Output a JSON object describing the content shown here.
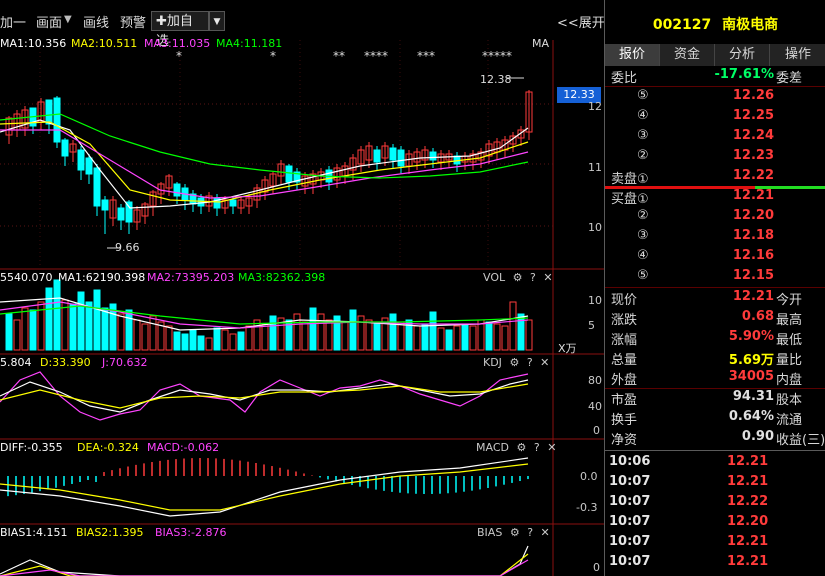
{
  "toolbar": {
    "items": [
      "加一",
      "画面",
      "画线",
      "预警"
    ],
    "add_watch": "✚加自选",
    "expand": "<<展开"
  },
  "price_chart": {
    "ma_labels": [
      {
        "text": "MA1:10.356",
        "color": "#ffffff"
      },
      {
        "text": "MA2:10.511",
        "color": "#ffff00"
      },
      {
        "text": "MA3:11.035",
        "color": "#ff44ff"
      },
      {
        "text": "MA4:11.181",
        "color": "#00ff00"
      }
    ],
    "ma_tag": "MA",
    "markers": [
      "*",
      "*",
      "**",
      "****",
      "***",
      "*****"
    ],
    "high_annotation": "12.38",
    "low_annotation": "9.66",
    "current_price_tag": "12.33",
    "y_ticks": [
      "12",
      "11",
      "10"
    ]
  },
  "volume_chart": {
    "labels": [
      {
        "text": "5540.070",
        "color": "#ffffff"
      },
      {
        "text": "MA1:62190.398",
        "color": "#ffffff"
      },
      {
        "text": "MA2:73395.203",
        "color": "#ff44ff"
      },
      {
        "text": "MA3:82362.398",
        "color": "#00ff00"
      }
    ],
    "name": "VOL",
    "y_ticks": [
      "10",
      "5"
    ],
    "unit": "X万"
  },
  "kdj_chart": {
    "labels": [
      {
        "text": "5.804",
        "color": "#ffffff"
      },
      {
        "text": "D:33.390",
        "color": "#ffff00"
      },
      {
        "text": "J:70.632",
        "color": "#ff44ff"
      }
    ],
    "name": "KDJ",
    "y_ticks": [
      "80",
      "40",
      "0"
    ]
  },
  "macd_chart": {
    "labels": [
      {
        "text": "DIFF:-0.355",
        "color": "#ffffff"
      },
      {
        "text": "DEA:-0.324",
        "color": "#ffff00"
      },
      {
        "text": "MACD:-0.062",
        "color": "#ff44ff"
      }
    ],
    "name": "MACD",
    "y_ticks": [
      "0.0",
      "-0.3"
    ]
  },
  "bias_chart": {
    "labels": [
      {
        "text": "BIAS1:4.151",
        "color": "#ffffff"
      },
      {
        "text": "BIAS2:1.395",
        "color": "#ffff00"
      },
      {
        "text": "BIAS3:-2.876",
        "color": "#ff44ff"
      }
    ],
    "name": "BIAS",
    "y_ticks": [
      "0"
    ]
  },
  "panel": {
    "stock_code": "002127",
    "stock_name": "南极电商",
    "tabs": [
      "报价",
      "资金",
      "分析",
      "操作"
    ],
    "weibi_label": "委比",
    "weibi_value": "-17.61%",
    "weicha_label": "委差",
    "sell_orders": [
      {
        "label": "⑤",
        "price": "12.26"
      },
      {
        "label": "④",
        "price": "12.25"
      },
      {
        "label": "③",
        "price": "12.24"
      },
      {
        "label": "②",
        "price": "12.23"
      },
      {
        "label": "卖盘①",
        "price": "12.22"
      }
    ],
    "buy_orders": [
      {
        "label": "买盘①",
        "price": "12.21"
      },
      {
        "label": "②",
        "price": "12.20"
      },
      {
        "label": "③",
        "price": "12.18"
      },
      {
        "label": "④",
        "price": "12.16"
      },
      {
        "label": "⑤",
        "price": "12.15"
      }
    ],
    "stats": [
      {
        "label": "现价",
        "value": "12.21",
        "label2": "今开",
        "color": "#ff3b3b"
      },
      {
        "label": "涨跌",
        "value": "0.68",
        "label2": "最高",
        "color": "#ff3b3b"
      },
      {
        "label": "涨幅",
        "value": "5.90%",
        "label2": "最低",
        "color": "#ff3b3b"
      },
      {
        "label": "总量",
        "value": "5.69万",
        "label2": "量比",
        "color": "#ffff00"
      },
      {
        "label": "外盘",
        "value": "34005",
        "label2": "内盘",
        "color": "#ff3b3b"
      }
    ],
    "stats2": [
      {
        "label": "市盈",
        "value": "94.31",
        "label2": "股本"
      },
      {
        "label": "换手",
        "value": "0.64%",
        "label2": "流通"
      },
      {
        "label": "净资",
        "value": "0.90",
        "label2": "收益(三)"
      }
    ],
    "ticks": [
      {
        "time": "10:06",
        "price": "12.21"
      },
      {
        "time": "10:07",
        "price": "12.21"
      },
      {
        "time": "10:07",
        "price": "12.22"
      },
      {
        "time": "10:07",
        "price": "12.20"
      },
      {
        "time": "10:07",
        "price": "12.21"
      },
      {
        "time": "10:07",
        "price": "12.21"
      }
    ]
  },
  "colors": {
    "up": "#ff3b3b",
    "down": "#00ffff",
    "ma1": "#ffffff",
    "ma2": "#ffff00",
    "ma3": "#ff44ff",
    "ma4": "#00ff00"
  }
}
